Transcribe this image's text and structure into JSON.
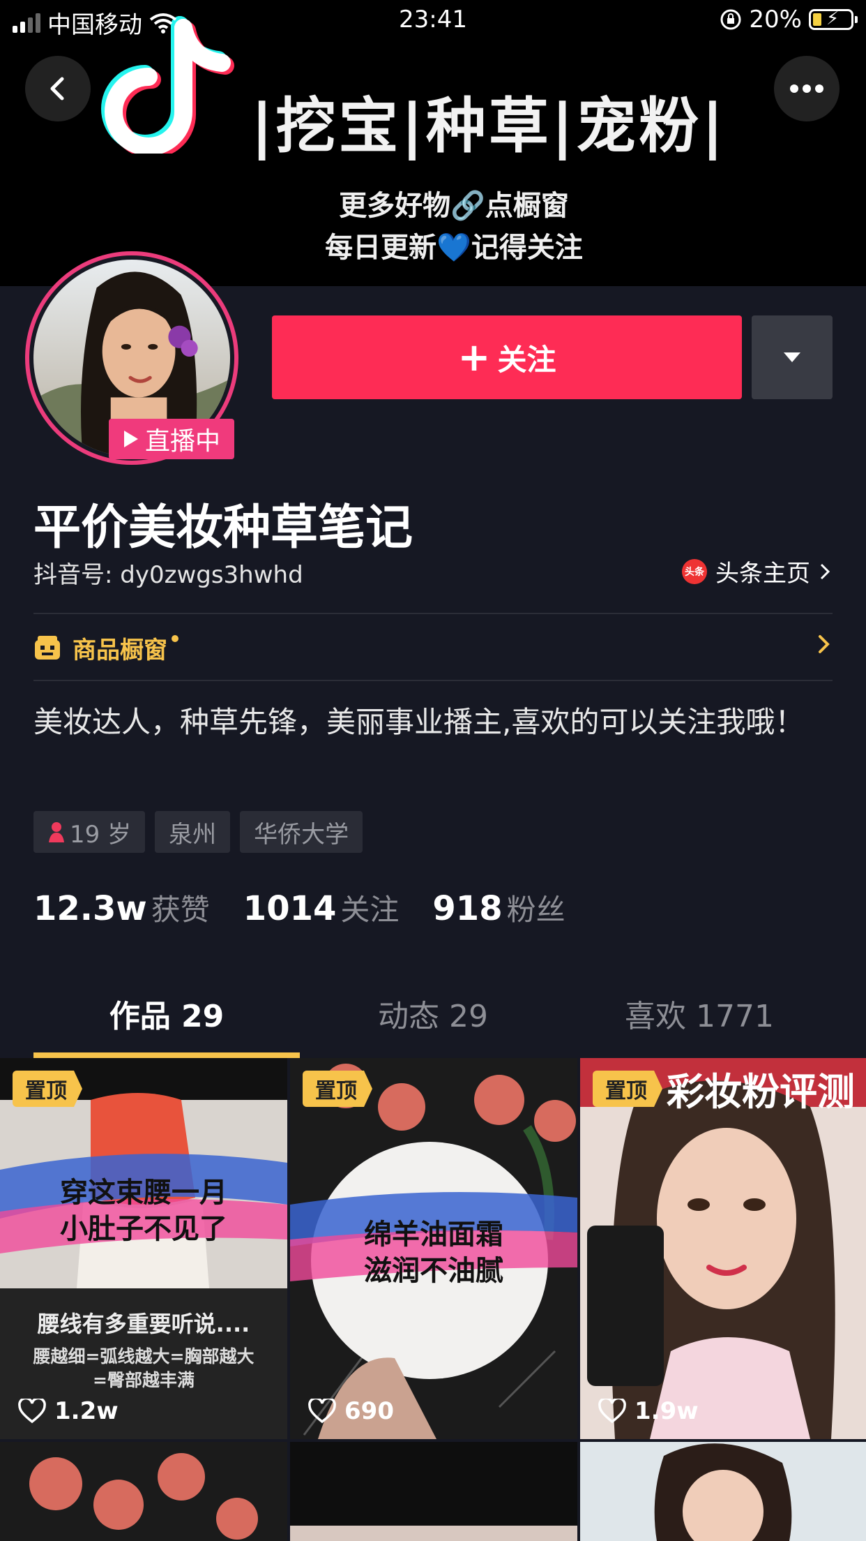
{
  "status_bar": {
    "carrier": "中国移动",
    "time": "23:41",
    "battery_percent": "20%",
    "battery_level": 0.2
  },
  "banner": {
    "tags_text": "|挖宝|种草|宠粉|",
    "line1": "更多好物🔗点橱窗",
    "line2": "每日更新💙记得关注"
  },
  "profile": {
    "live_label": "直播中",
    "follow_label": "关注",
    "nickname": "平价美妆种草笔记",
    "douyin_id": "抖音号: dy0zwgs3hwhd",
    "toutiao_label": "头条主页",
    "toutiao_icon_text": "头条",
    "shop_label": "商品橱窗",
    "bio": "美妆达人，种草先锋，美丽事业播主,喜欢的可以关注我哦！",
    "tags": [
      {
        "label": "19 岁",
        "icon": "female-icon"
      },
      {
        "label": "泉州"
      },
      {
        "label": "华侨大学"
      }
    ],
    "stats": [
      {
        "value": "12.3w",
        "label": "获赞"
      },
      {
        "value": "1014",
        "label": "关注"
      },
      {
        "value": "918",
        "label": "粉丝"
      }
    ]
  },
  "tabs": [
    {
      "label": "作品 29",
      "active": true
    },
    {
      "label": "动态 29",
      "active": false
    },
    {
      "label": "喜欢 1771",
      "active": false
    }
  ],
  "videos": [
    {
      "pinned_label": "置顶",
      "likes": "1.2w",
      "title_line1": "穿这束腰一月",
      "title_line2": "小肚子不见了",
      "caption1": "腰线有多重要听说....",
      "caption2": "腰越细=弧线越大=胸部越大",
      "caption3": "=臀部越丰满"
    },
    {
      "pinned_label": "置顶",
      "likes": "690",
      "title_line1": "绵羊油面霜",
      "title_line2": "滋润不油腻"
    },
    {
      "pinned_label": "置顶",
      "likes": "1.9w",
      "header_text": "彩妆粉评测"
    }
  ],
  "colors": {
    "background": "#161823",
    "follow": "#fe2c55",
    "accent_yellow": "#f7c34b",
    "live_pink": "#f03a7c"
  }
}
